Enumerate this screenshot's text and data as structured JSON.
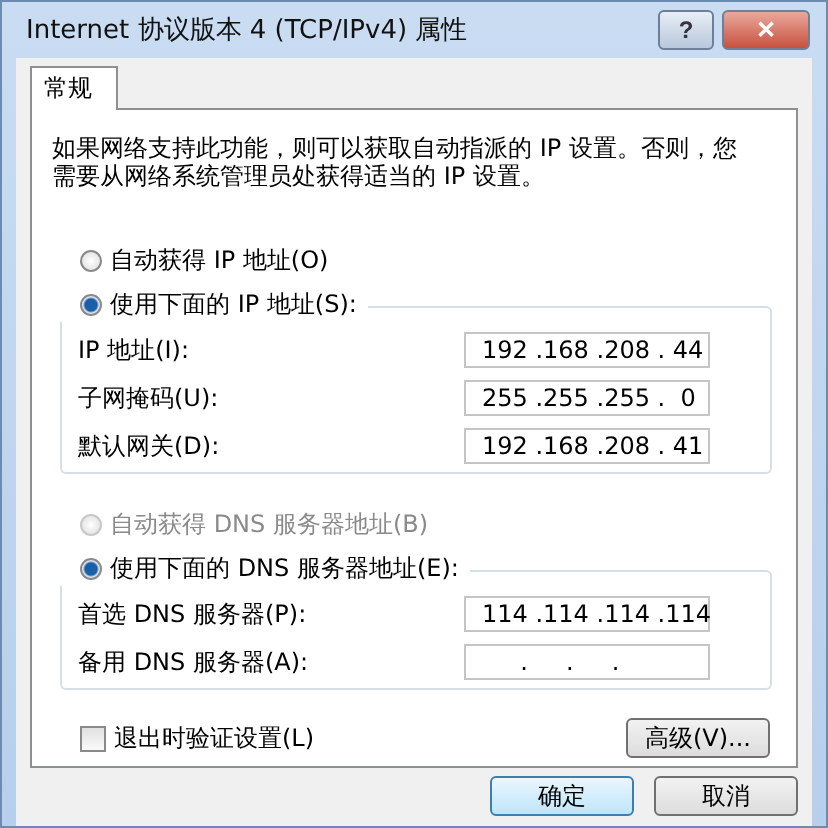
{
  "window": {
    "title": "Internet 协议版本 4 (TCP/IPv4) 属性",
    "help": "?",
    "close": "✕"
  },
  "tabs": [
    {
      "label": "常规",
      "selected": true
    }
  ],
  "description": "如果网络支持此功能，则可以获取自动指派的 IP 设置。否则，您需要从网络系统管理员处获得适当的 IP 设置。",
  "ip_auto": {
    "label": "自动获得 IP 地址(O)",
    "selected": false,
    "disabled": false
  },
  "ip_manual": {
    "label": "使用下面的 IP 地址(S):",
    "selected": true,
    "disabled": false,
    "fields": [
      {
        "label": "IP 地址(I):",
        "value": "192 .168 .208 . 44"
      },
      {
        "label": "子网掩码(U):",
        "value": "255 .255 .255 .  0"
      },
      {
        "label": "默认网关(D):",
        "value": "192 .168 .208 . 41"
      }
    ]
  },
  "dns_auto": {
    "label": "自动获得 DNS 服务器地址(B)",
    "selected": false,
    "disabled": true
  },
  "dns_manual": {
    "label": "使用下面的 DNS 服务器地址(E):",
    "selected": true,
    "disabled": false,
    "fields": [
      {
        "label": "首选 DNS 服务器(P):",
        "value": "114 .114 .114 .114"
      },
      {
        "label": "备用 DNS 服务器(A):",
        "value": "     .     .     ."
      }
    ]
  },
  "validate": {
    "label": "退出时验证设置(L)",
    "checked": false
  },
  "advanced_button": "高级(V)...",
  "buttons": [
    {
      "label": "确定",
      "default": true
    },
    {
      "label": "取消",
      "default": false
    }
  ]
}
